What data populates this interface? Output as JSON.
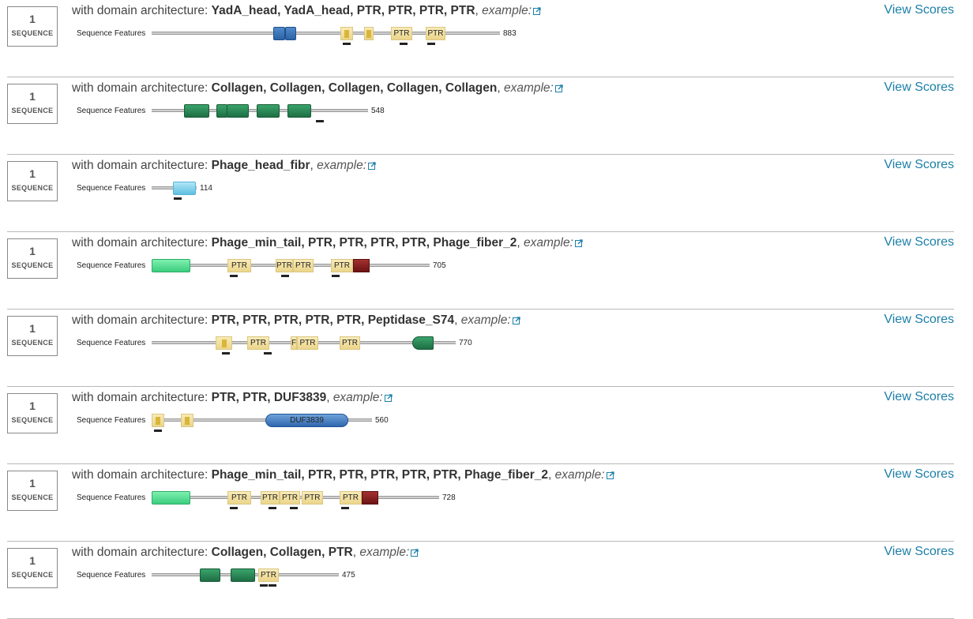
{
  "colors": {
    "link": "#1b7fa8",
    "ptr": "#ebd58c",
    "blue": "#2c63a6",
    "green": "#1e6e44",
    "maroon": "#6b1414"
  },
  "common": {
    "view_scores": "View Scores",
    "seq_features": "Sequence Features",
    "prefix": "with domain architecture:",
    "example": "example:",
    "count_label": "SEQUENCE",
    "external_icon": "external-link-icon"
  },
  "rows": [
    {
      "count": "1",
      "architecture": "YadA_head, YadA_head, PTR, PTR, PTR, PTR",
      "length": "883",
      "domain_labels": [
        "PTR",
        "PTR"
      ]
    },
    {
      "count": "1",
      "architecture": "Collagen, Collagen, Collagen, Collagen, Collagen",
      "length": "548"
    },
    {
      "count": "1",
      "architecture": "Phage_head_fibr",
      "length": "114"
    },
    {
      "count": "1",
      "architecture": "Phage_min_tail, PTR, PTR, PTR, PTR, Phage_fiber_2",
      "length": "705",
      "domain_labels": [
        "PTR",
        "PTR",
        "PTR",
        "PTR"
      ]
    },
    {
      "count": "1",
      "architecture": "PTR, PTR, PTR, PTR, PTR, Peptidase_S74",
      "length": "770",
      "domain_labels": [
        "PTR",
        "F",
        "PTR",
        "PTR"
      ]
    },
    {
      "count": "1",
      "architecture": "PTR, PTR, DUF3839",
      "length": "560",
      "domain_labels": [
        "DUF3839"
      ]
    },
    {
      "count": "1",
      "architecture": "Phage_min_tail, PTR, PTR, PTR, PTR, PTR, Phage_fiber_2",
      "length": "728",
      "domain_labels": [
        "PTR",
        "PTR",
        "PTR",
        "PTR",
        "PTR"
      ]
    },
    {
      "count": "1",
      "architecture": "Collagen, Collagen, PTR",
      "length": "475",
      "domain_labels": [
        "PTR"
      ]
    }
  ]
}
